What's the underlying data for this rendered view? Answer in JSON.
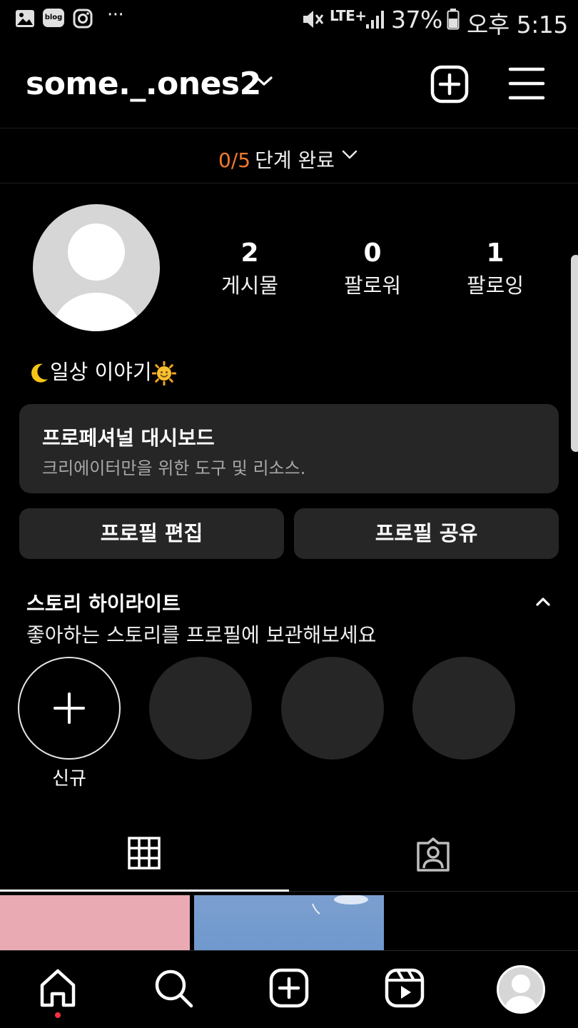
{
  "status_bar": {
    "icons_left": [
      "gallery-icon",
      "blog-icon",
      "instagram-icon",
      "more-dots-icon"
    ],
    "blog_label": "blog",
    "dots": "···",
    "network": "LTE+",
    "battery": "37%",
    "time": "오후 5:15"
  },
  "header": {
    "username": "some._.ones2"
  },
  "steps": {
    "progress": "0/5",
    "label": "단계 완료"
  },
  "profile": {
    "stats": [
      {
        "value": "2",
        "label": "게시물"
      },
      {
        "value": "0",
        "label": "팔로워"
      },
      {
        "value": "1",
        "label": "팔로잉"
      }
    ],
    "bio_text": "일상 이야기",
    "bio_emojis": [
      "crescent-moon",
      "sun-with-face"
    ]
  },
  "dashboard": {
    "title": "프로페셔널 대시보드",
    "subtitle": "크리에이터만을 위한 도구 및 리소스."
  },
  "buttons": {
    "edit_profile": "프로필 편집",
    "share_profile": "프로필 공유"
  },
  "highlights": {
    "title": "스토리 하이라이트",
    "subtitle": "좋아하는 스토리를 프로필에 보관해보세요",
    "new_label": "신규"
  },
  "tabs": [
    "grid-icon",
    "tagged-icon"
  ],
  "nav": [
    "home-icon",
    "search-icon",
    "create-icon",
    "reels-icon",
    "profile-avatar"
  ],
  "colors": {
    "accent": "#f07a2e",
    "surface": "#262626",
    "notification": "#ff3040"
  }
}
